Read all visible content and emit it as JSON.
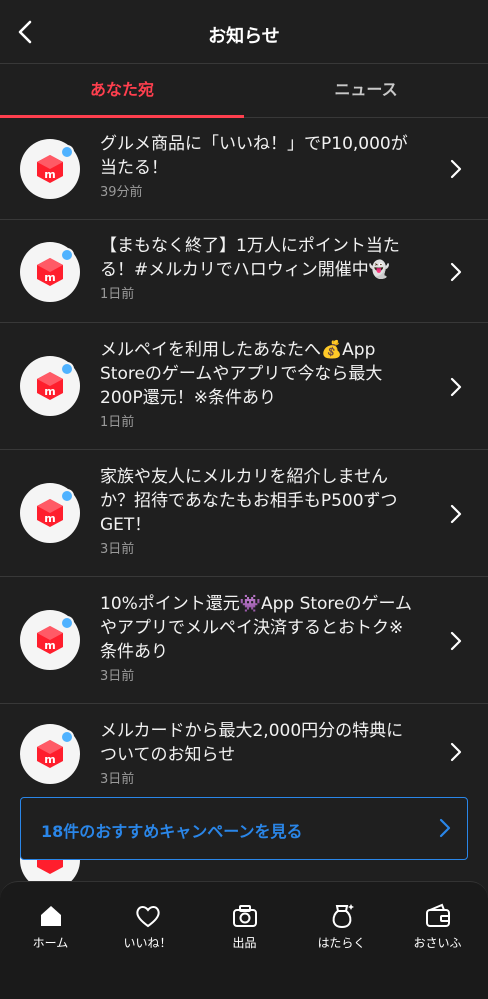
{
  "header": {
    "title": "お知らせ",
    "back_icon": "chevron-left-icon"
  },
  "tabs": [
    {
      "label": "あなた宛",
      "active": true
    },
    {
      "label": "ニュース",
      "active": false
    }
  ],
  "notifications": [
    {
      "text": "グルメ商品に「いいね！」でP10,000が当たる！",
      "time": "39分前"
    },
    {
      "text": "【まもなく終了】1万人にポイント当たる！#メルカリでハロウィン開催中👻",
      "time": "1日前"
    },
    {
      "text": "メルペイを利用したあなたへ💰App Storeのゲームやアプリで今なら最大200P還元！※条件あり",
      "time": "1日前"
    },
    {
      "text": "家族や友人にメルカリを紹介しませんか？招待であなたもお相手もP500ずつGET！",
      "time": "3日前"
    },
    {
      "text": "10%ポイント還元👾App Storeのゲームやアプリでメルペイ決済するとおトク※条件あり",
      "time": "3日前"
    },
    {
      "text": "メルカードから最大2,000円分の特典についてのお知らせ",
      "time": "3日前"
    }
  ],
  "campaign": {
    "label": "18件のおすすめキャンペーンを見る"
  },
  "bottom_nav": [
    {
      "label": "ホーム",
      "icon": "home-icon"
    },
    {
      "label": "いいね！",
      "icon": "heart-icon"
    },
    {
      "label": "出品",
      "icon": "camera-icon"
    },
    {
      "label": "はたらく",
      "icon": "money-bag-icon"
    },
    {
      "label": "おさいふ",
      "icon": "wallet-icon"
    }
  ],
  "colors": {
    "accent": "#ff3f4e",
    "link": "#2a86e8",
    "background": "#1f1f1f",
    "dot": "#4fb2ff"
  }
}
